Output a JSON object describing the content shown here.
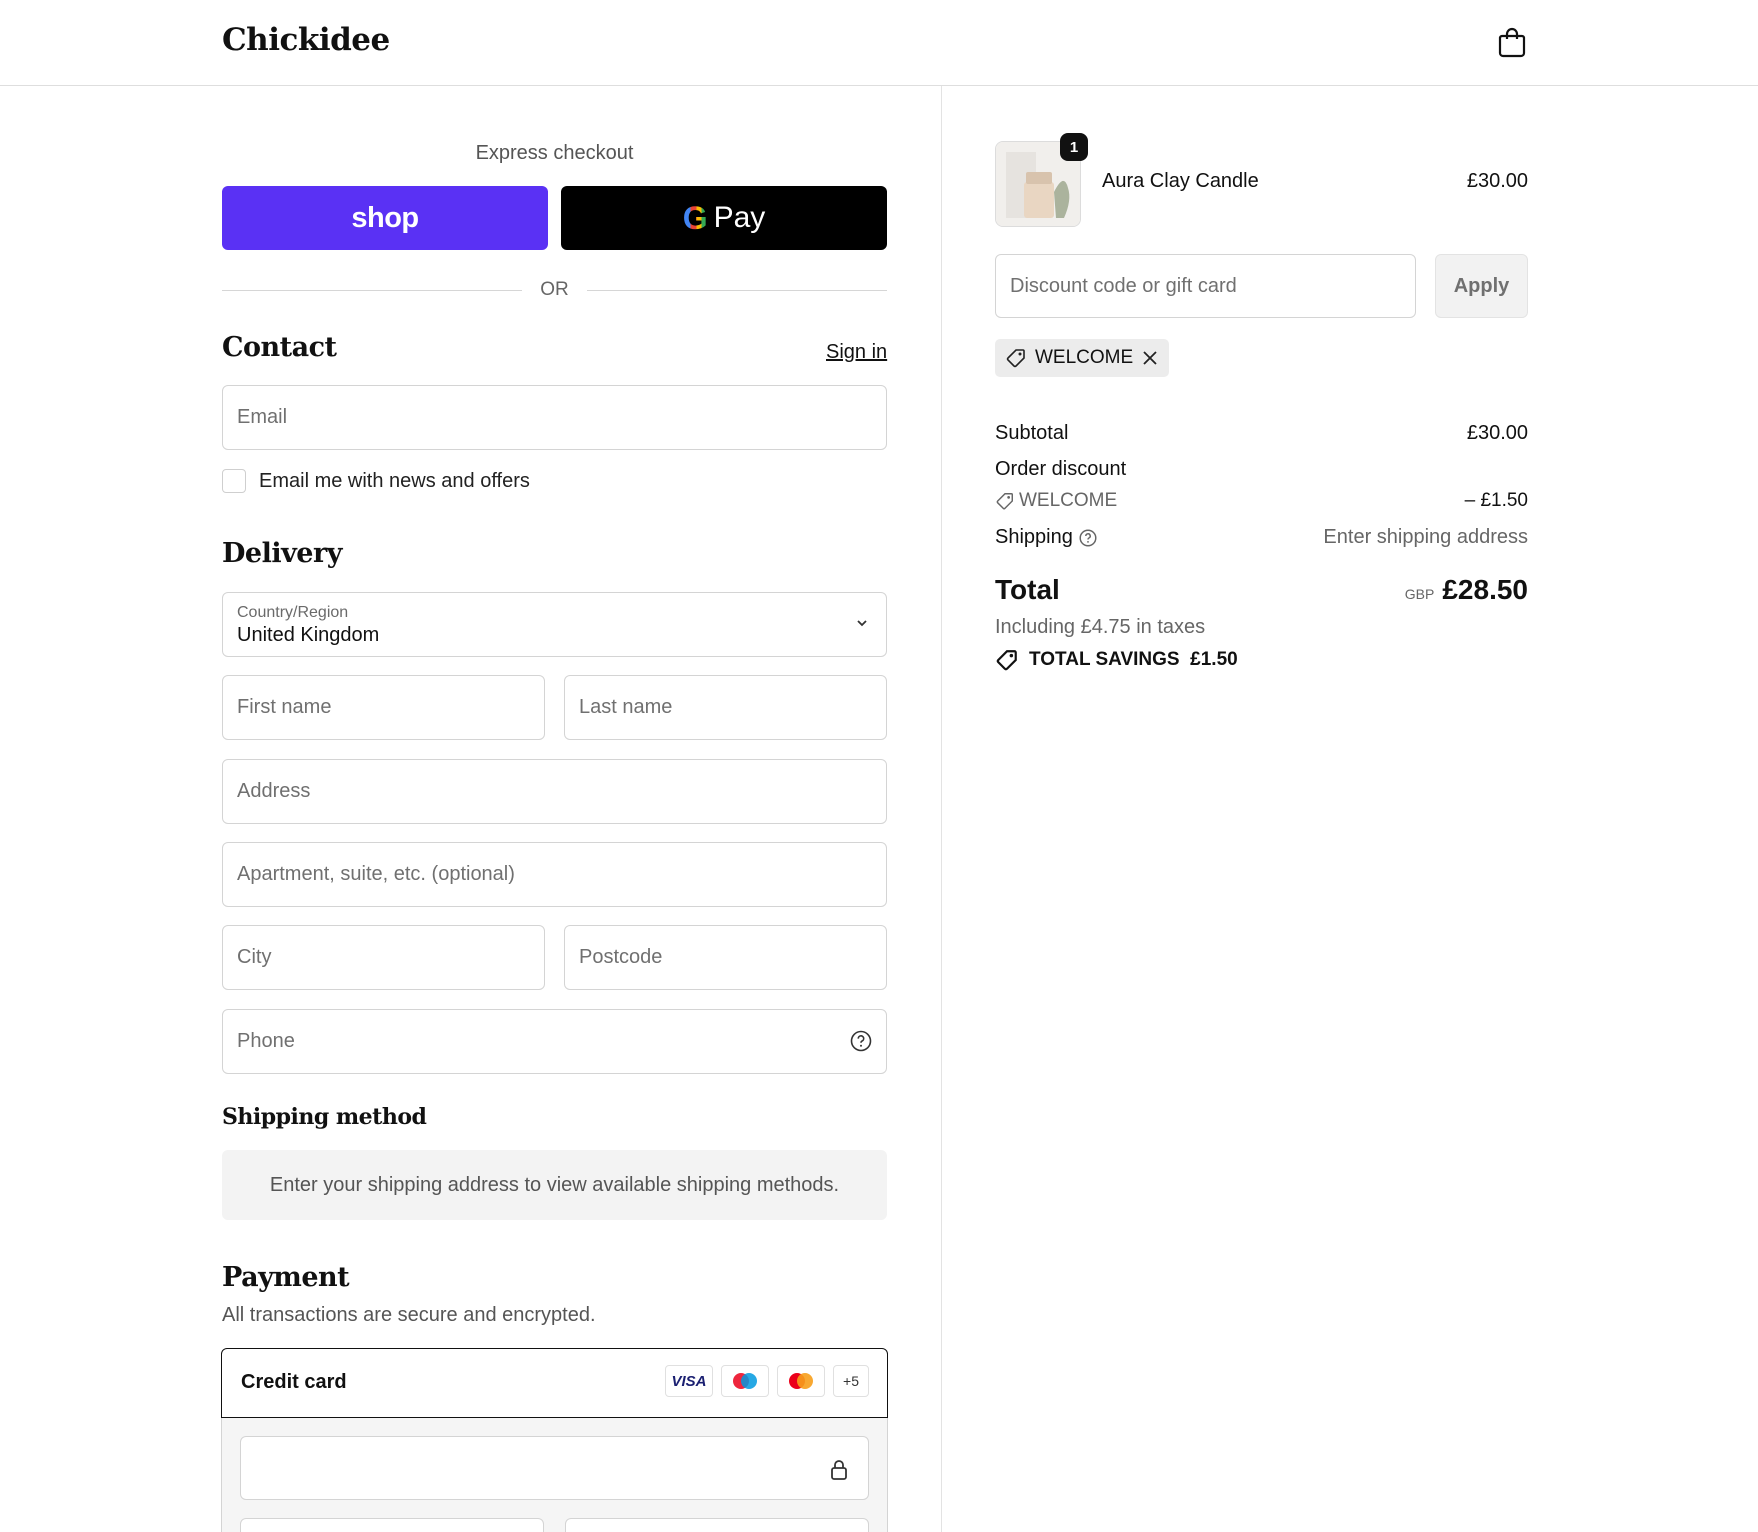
{
  "header": {
    "logo": "Chickidee",
    "cart_icon": "shopping-bag-icon"
  },
  "express": {
    "label": "Express checkout",
    "shop_label": "shop",
    "gpay_label": "Pay",
    "gpay_g": "G",
    "or_label": "OR"
  },
  "contact": {
    "title": "Contact",
    "sign_in": "Sign in",
    "email_placeholder": "Email",
    "newsletter_label": "Email me with news and offers"
  },
  "delivery": {
    "title": "Delivery",
    "country_label": "Country/Region",
    "country_value": "United Kingdom",
    "first_name": "First name",
    "last_name": "Last name",
    "address": "Address",
    "apartment": "Apartment, suite, etc. (optional)",
    "city": "City",
    "postcode": "Postcode",
    "phone": "Phone"
  },
  "shipping_method": {
    "title": "Shipping method",
    "note": "Enter your shipping address to view available shipping methods."
  },
  "payment": {
    "title": "Payment",
    "subtitle": "All transactions are secure and encrypted.",
    "credit_card_label": "Credit card",
    "cards": [
      "VISA",
      "maestro",
      "mastercard"
    ],
    "more_cards": "+5"
  },
  "summary": {
    "item": {
      "name": "Aura Clay Candle",
      "price": "£30.00",
      "quantity": "1"
    },
    "discount_placeholder": "Discount code or gift card",
    "apply_label": "Apply",
    "applied_code": "WELCOME",
    "subtotal_label": "Subtotal",
    "subtotal_value": "£30.00",
    "order_discount_label": "Order discount",
    "discount_code": "WELCOME",
    "discount_value": "– £1.50",
    "shipping_label": "Shipping",
    "shipping_value": "Enter shipping address",
    "total_label": "Total",
    "currency": "GBP",
    "total_value": "£28.50",
    "taxes": "Including £4.75 in taxes",
    "savings": "TOTAL SAVINGS  £1.50"
  },
  "colors": {
    "shop_purple": "#5a31f4",
    "gpay_black": "#000000"
  }
}
